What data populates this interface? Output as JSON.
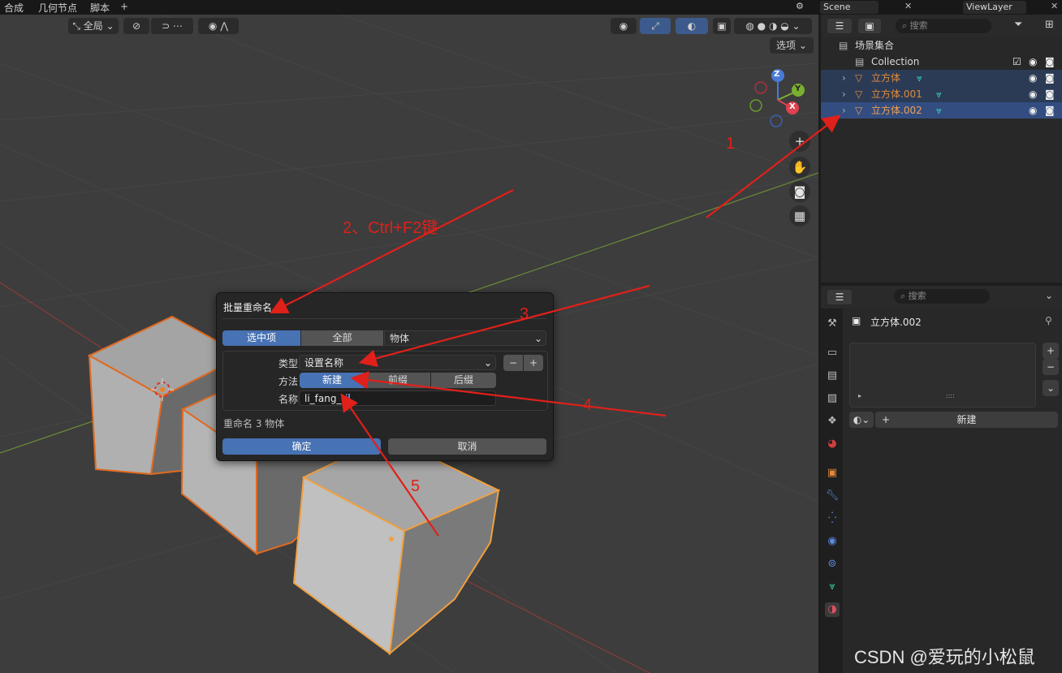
{
  "menu": {
    "items": [
      "合成",
      "几何节点",
      "脚本"
    ],
    "add": "+"
  },
  "viewport_header": {
    "transform_orientation": "全局",
    "options": "选项"
  },
  "gizmo": {
    "x": "X",
    "y": "Y",
    "z": "Z"
  },
  "scene": {
    "scene_name": "Scene",
    "view_layer": "ViewLayer"
  },
  "outliner": {
    "search_placeholder": "搜索",
    "scene_collection": "场景集合",
    "collection": "Collection",
    "objects": [
      "立方体",
      "立方体.001",
      "立方体.002"
    ]
  },
  "dialog": {
    "title": "批量重命名",
    "data_source": {
      "selected": "选中项",
      "all": "全部",
      "type": "物体"
    },
    "type_label": "类型",
    "type_value": "设置名称",
    "method_label": "方法",
    "methods": [
      "新建",
      "前缀",
      "后缀"
    ],
    "name_label": "名称",
    "name_value": "li_fang_ti",
    "summary": "重命名 3 物体",
    "ok": "确定",
    "cancel": "取消"
  },
  "properties": {
    "search_placeholder": "搜索",
    "object_name": "立方体.002",
    "new_button": "新建",
    "list_dots": "::::"
  },
  "annotations": {
    "a1": "1",
    "a2": "2、Ctrl+F2键",
    "a3": "3",
    "a4": "4",
    "a5": "5"
  },
  "watermark": "CSDN @爱玩的小松鼠",
  "colors": {
    "accent": "#4772b3",
    "selected_row": "#334d80",
    "object_name": "#e08a3a",
    "annotation": "#e0201a"
  }
}
